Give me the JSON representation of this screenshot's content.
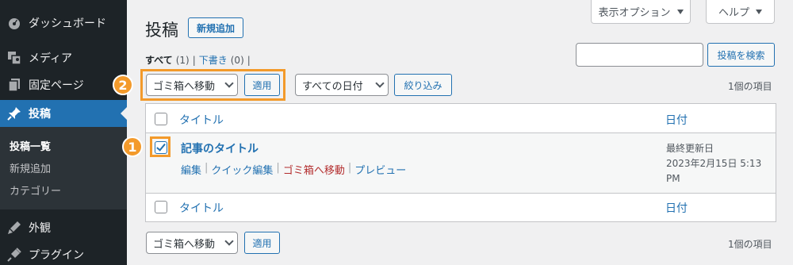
{
  "sidebar": {
    "items": [
      {
        "label": "ダッシュボード",
        "icon": "dashboard-icon"
      },
      {
        "label": "メディア",
        "icon": "media-icon"
      },
      {
        "label": "固定ページ",
        "icon": "pages-icon"
      },
      {
        "label": "投稿",
        "icon": "pin-icon"
      },
      {
        "label": "外観",
        "icon": "appearance-icon"
      },
      {
        "label": "プラグイン",
        "icon": "plugins-icon"
      }
    ],
    "submenu": [
      "投稿一覧",
      "新規追加",
      "カテゴリー"
    ]
  },
  "header": {
    "title": "投稿",
    "add_new": "新規追加",
    "screen_options": "表示オプション",
    "help": "ヘルプ"
  },
  "views": {
    "all_label": "すべて",
    "all_count": "(1)",
    "drafts_label": "下書き",
    "drafts_count": "(0)",
    "sep": "|"
  },
  "search": {
    "button": "投稿を検索",
    "value": ""
  },
  "bulk_top": {
    "selected": "ゴミ箱へ移動",
    "apply": "適用"
  },
  "filters": {
    "date_selected": "すべての日付",
    "filter_button": "絞り込み"
  },
  "items_count": "1個の項目",
  "table": {
    "col_title": "タイトル",
    "col_date": "日付",
    "post": {
      "title": "記事のタイトル",
      "actions": [
        "編集",
        "クイック編集",
        "ゴミ箱へ移動",
        "プレビュー"
      ],
      "date_status": "最終更新日",
      "date_value": "2023年2月15日 5:13",
      "date_ampm": "PM"
    }
  },
  "bulk_bottom": {
    "selected": "ゴミ箱へ移動",
    "apply": "適用"
  },
  "annotations": {
    "one": "1",
    "two": "2",
    "color": "#f39a2b"
  }
}
